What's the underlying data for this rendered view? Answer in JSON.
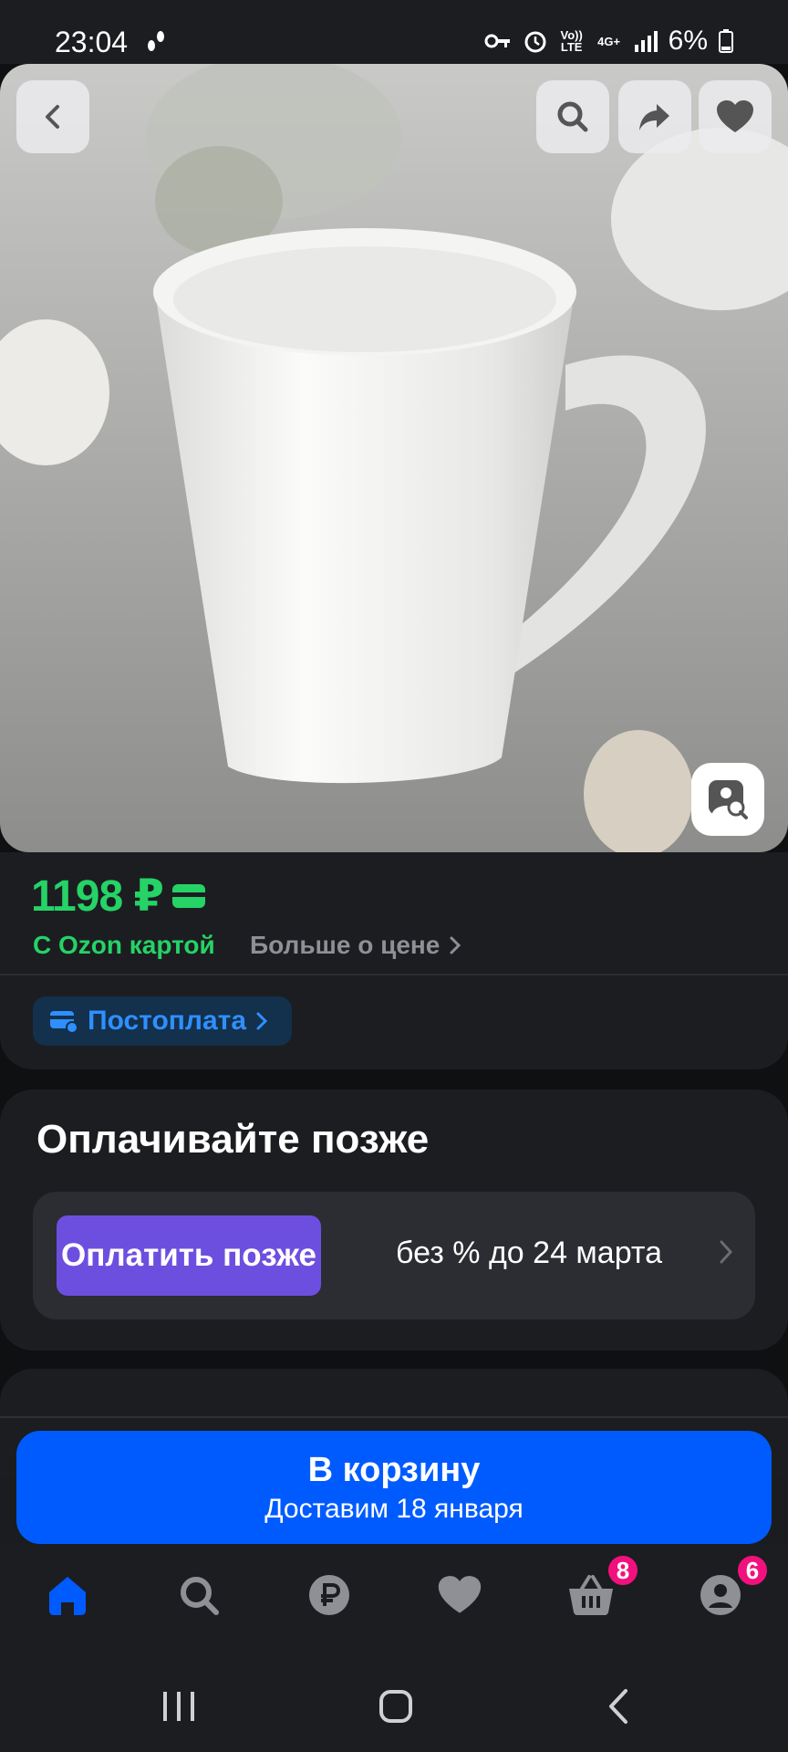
{
  "status_bar": {
    "time": "23:04",
    "network_1": "Vo)) LTE",
    "network_2": "4G+",
    "battery": "6%"
  },
  "hero": {
    "image_subject": "white mug photo",
    "icons": [
      "back-icon",
      "search-icon",
      "share-icon",
      "heart-icon",
      "image-search-icon"
    ]
  },
  "price": {
    "value": "1198 ₽",
    "ozon_card_label": "С Ozon картой",
    "more_about_price": "Больше о цене",
    "postpay_label": "Постоплата"
  },
  "pay_later": {
    "title": "Оплачивайте позже",
    "button_label": "Оплатить позже",
    "terms": "без % до 24 марта"
  },
  "next_section": {
    "peek_title": ""
  },
  "cart": {
    "title": "В корзину",
    "delivery": "Доставим 18 января"
  },
  "bottom_nav": {
    "items": [
      {
        "name": "home",
        "icon": "home-icon",
        "active": true
      },
      {
        "name": "search",
        "icon": "search-icon"
      },
      {
        "name": "finance",
        "icon": "ruble-icon"
      },
      {
        "name": "favorites",
        "icon": "heart-icon"
      },
      {
        "name": "cart",
        "icon": "basket-icon",
        "badge": "8"
      },
      {
        "name": "profile",
        "icon": "profile-icon",
        "badge": "6"
      }
    ]
  },
  "colors": {
    "accent_green": "#25d366",
    "accent_blue": "#005bff",
    "purple": "#6d4fe0",
    "badge_pink": "#f1117e",
    "card_bg": "#1c1d21"
  }
}
